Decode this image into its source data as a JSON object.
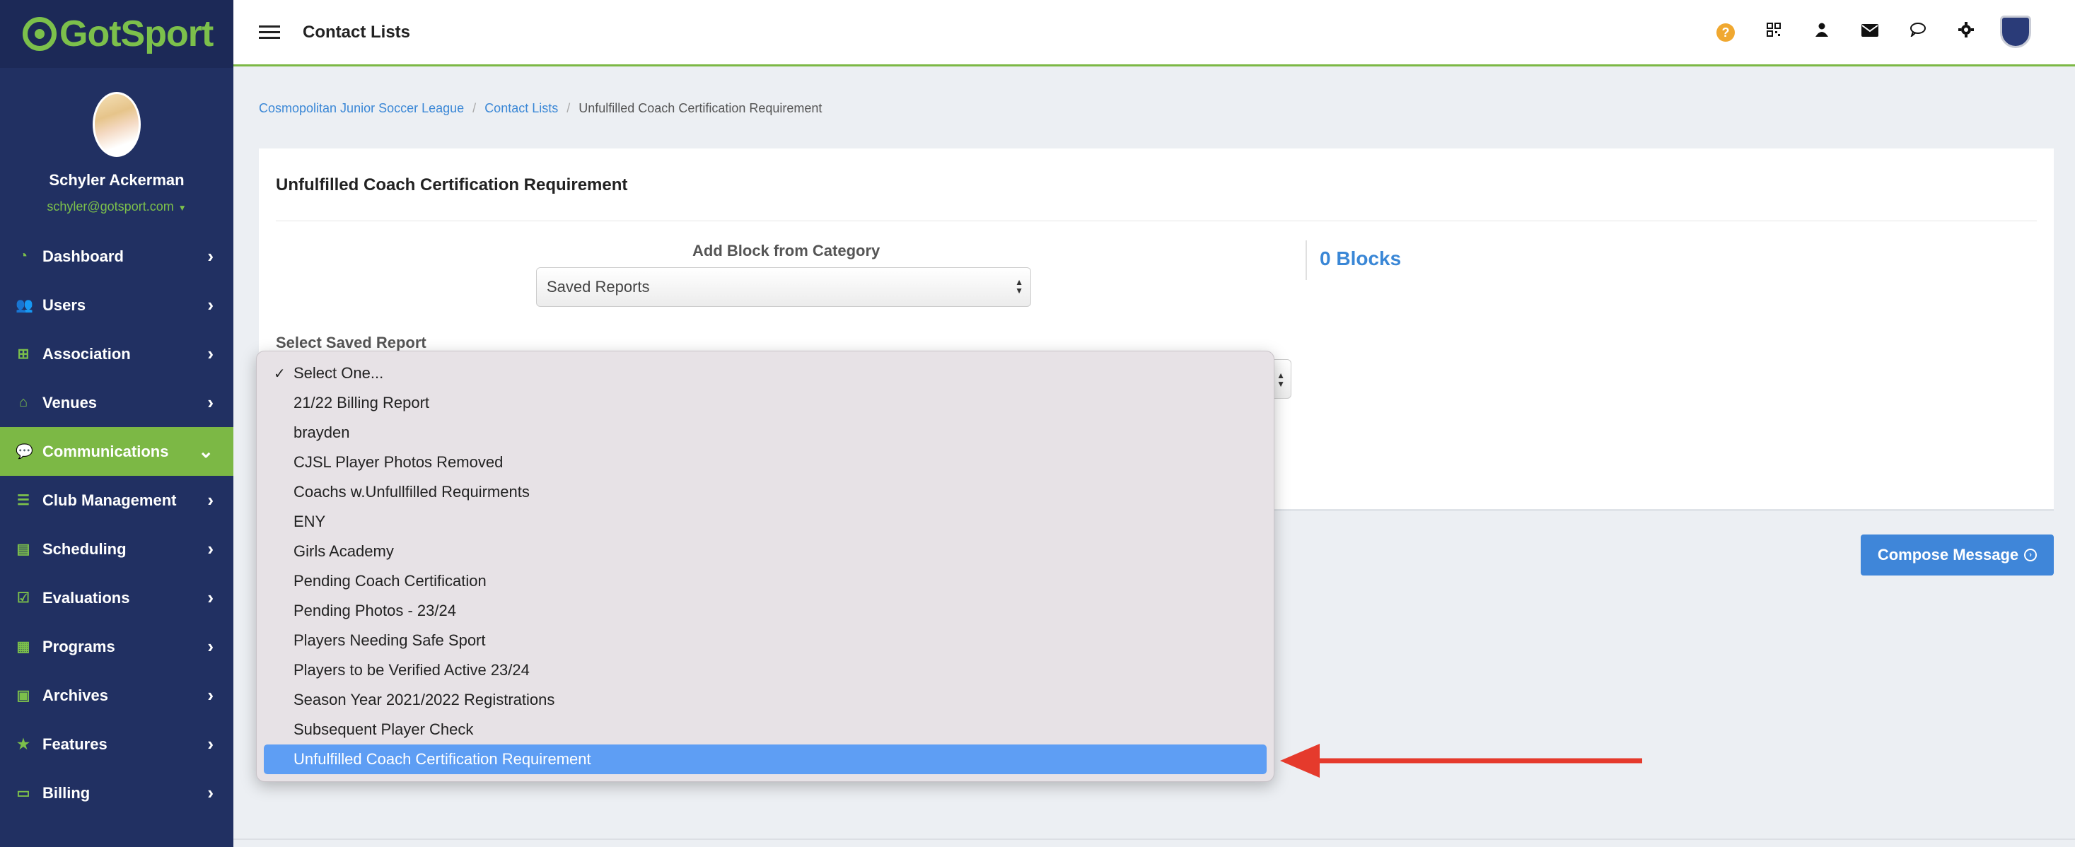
{
  "app": {
    "logo_text": "GotSport"
  },
  "profile": {
    "name": "Schyler Ackerman",
    "email": "schyler@gotsport.com"
  },
  "sidebar": {
    "items": [
      {
        "label": "Dashboard",
        "icon": "dashboard-icon"
      },
      {
        "label": "Users",
        "icon": "users-icon"
      },
      {
        "label": "Association",
        "icon": "sitemap-icon"
      },
      {
        "label": "Venues",
        "icon": "home-icon"
      },
      {
        "label": "Communications",
        "icon": "chat-icon",
        "active": true
      },
      {
        "label": "Club Management",
        "icon": "list-icon"
      },
      {
        "label": "Scheduling",
        "icon": "calendar-list-icon"
      },
      {
        "label": "Evaluations",
        "icon": "calendar-check-icon"
      },
      {
        "label": "Programs",
        "icon": "document-icon"
      },
      {
        "label": "Archives",
        "icon": "archive-icon"
      },
      {
        "label": "Features",
        "icon": "star-icon"
      },
      {
        "label": "Billing",
        "icon": "credit-card-icon"
      }
    ]
  },
  "header": {
    "title": "Contact Lists",
    "icons": [
      "help-icon",
      "qr-code-icon",
      "user-icon",
      "envelope-icon",
      "chat-icon",
      "gear-icon",
      "league-crest-icon"
    ]
  },
  "breadcrumb": {
    "items": [
      "Cosmopolitan Junior Soccer League",
      "Contact Lists"
    ],
    "current": "Unfulfilled Coach Certification Requirement"
  },
  "card": {
    "title": "Unfulfilled Coach Certification Requirement",
    "add_block_label": "Add Block from Category",
    "category_value": "Saved Reports",
    "blocks_count": "0 Blocks",
    "saved_report_label": "Select Saved Report"
  },
  "dropdown": {
    "options": [
      "Select One...",
      "21/22 Billing Report",
      "brayden",
      "CJSL Player Photos Removed",
      "Coachs w.Unfullfilled Requirments",
      "ENY",
      "Girls Academy",
      "Pending Coach Certification",
      "Pending Photos - 23/24",
      "Players Needing Safe Sport",
      "Players to be Verified Active 23/24",
      "Season Year 2021/2022 Registrations",
      "Subsequent Player Check",
      "Unfulfilled Coach Certification Requirement"
    ],
    "checked_index": 0,
    "highlighted_index": 13
  },
  "compose": {
    "label": "Compose Message"
  },
  "colors": {
    "sidebar": "#213062",
    "accent_green": "#7cb845",
    "link_blue": "#3a87d6",
    "highlight": "#5e9ef4",
    "annotation_red": "#e53a2c"
  }
}
